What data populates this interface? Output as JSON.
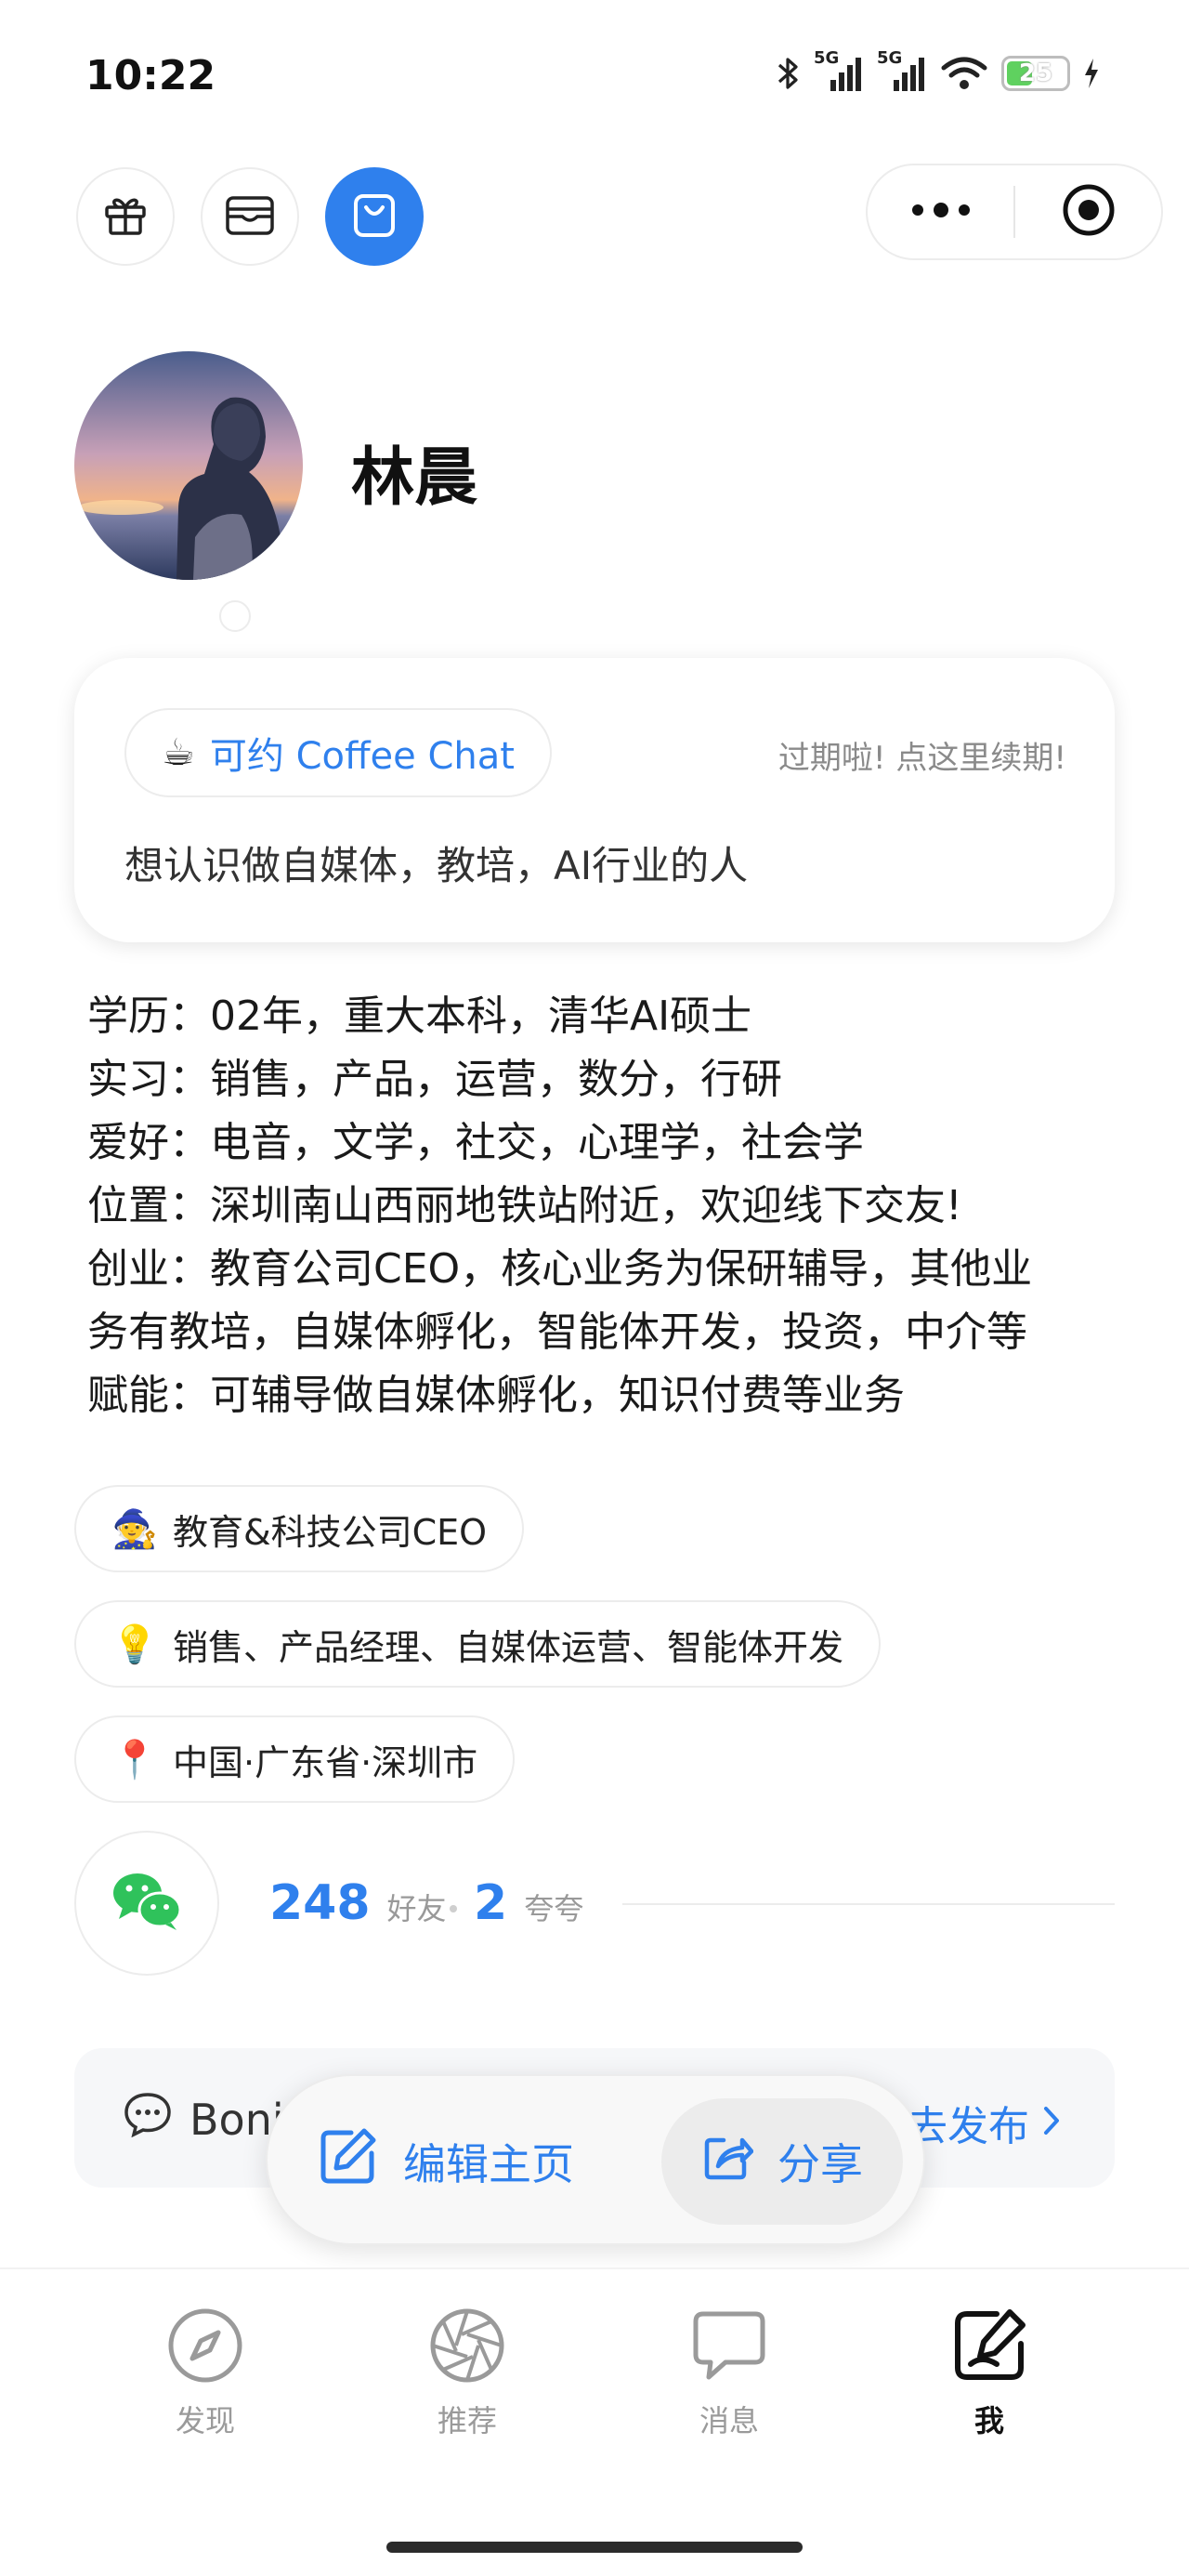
{
  "status_bar": {
    "time": "10:22",
    "network_1": "5G",
    "network_2": "5G",
    "battery": "25"
  },
  "profile": {
    "name": "林晨"
  },
  "coffee_chat": {
    "cup_icon": "☕",
    "label": "可约 Coffee Chat",
    "expire_text": "过期啦! 点这里续期!",
    "description": "想认识做自媒体，教培，AI行业的人"
  },
  "bio": {
    "lines": [
      "学历：02年，重大本科，清华AI硕士",
      "实习：销售，产品，运营，数分，行研",
      "爱好：电音，文学，社交，心理学，社会学",
      "位置：深圳南山西丽地铁站附近，欢迎线下交友!",
      "创业：教育公司CEO，核心业务为保研辅导，其他业",
      "务有教培，自媒体孵化，智能体开发，投资，中介等",
      "赋能：可辅导做自媒体孵化，知识付费等业务"
    ]
  },
  "tags": [
    {
      "emoji": "🧙",
      "text": "教育&科技公司CEO"
    },
    {
      "emoji": "💡",
      "text": "销售、产品经理、自媒体运营、智能体开发"
    },
    {
      "emoji": "📍",
      "text": "中国·广东省·深圳市"
    }
  ],
  "stats": {
    "friends_count": "248",
    "friends_label": "好友",
    "praise_count": "2",
    "praise_label": "夸夸"
  },
  "bonjour_bar": {
    "left_text": "Bonj",
    "right_text": "去发布"
  },
  "float_actions": {
    "edit_label": "编辑主页",
    "share_label": "分享"
  },
  "tabbar": {
    "items": [
      {
        "label": "发现",
        "icon": "compass-icon"
      },
      {
        "label": "推荐",
        "icon": "aperture-icon"
      },
      {
        "label": "消息",
        "icon": "message-icon"
      },
      {
        "label": "我",
        "icon": "edit-profile-icon"
      }
    ]
  },
  "colors": {
    "accent": "#2f80ed",
    "wechat_green": "#2fc25b"
  }
}
